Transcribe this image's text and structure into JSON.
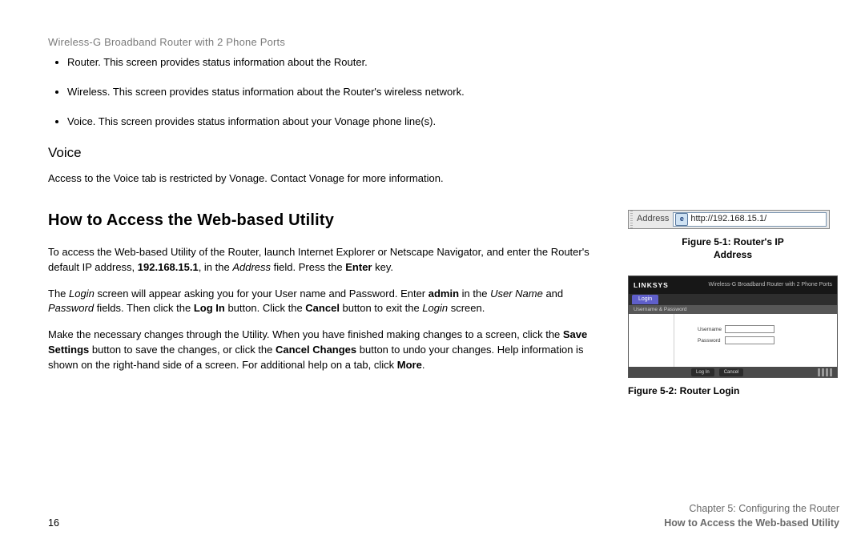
{
  "header": "Wireless-G Broadband Router with 2 Phone Ports",
  "bullets": {
    "b1": "Router. This screen provides status information about the Router.",
    "b2": "Wireless. This screen provides status information about the Router's wireless network.",
    "b3": "Voice. This screen provides status information about your Vonage phone line(s)."
  },
  "voice": {
    "heading": "Voice",
    "text": "Access to the Voice tab is restricted by Vonage. Contact Vonage for more information."
  },
  "access": {
    "heading": "How to Access the Web-based Utility",
    "p1a": "To access the Web-based Utility of the Router, launch Internet Explorer or Netscape Navigator, and enter the Router's default IP address, ",
    "p1_ip": "192.168.15.1",
    "p1b": ", in the ",
    "p1_addr": "Address",
    "p1c": " field. Press the ",
    "p1_enter": "Enter",
    "p1d": " key.",
    "p2a": "The ",
    "p2_login": "Login",
    "p2b": " screen will appear asking you for your User name and Password. Enter ",
    "p2_admin": "admin",
    "p2c": " in the ",
    "p2_username": "User Name",
    "p2d": " and ",
    "p2_password": "Password",
    "p2e": " fields. Then click the ",
    "p2_loginbtn": "Log In",
    "p2f": " button. Click the ",
    "p2_cancel": "Cancel",
    "p2g": " button to exit the ",
    "p2_loginscr": "Login",
    "p2h": " screen.",
    "p3a": "Make the necessary changes through the Utility. When you have finished making changes to a screen, click the ",
    "p3_save": "Save Settings",
    "p3b": " button to save the changes, or click the ",
    "p3_cancelchg": "Cancel Changes",
    "p3c": " button to undo your changes. Help information is shown on the right-hand side of a screen. For additional help on a tab, click ",
    "p3_more": "More",
    "p3d": "."
  },
  "figures": {
    "f1": {
      "address_label": "Address",
      "url": "http://192.168.15.1/",
      "caption_l1": "Figure 5-1: Router's IP",
      "caption_l2": "Address"
    },
    "f2": {
      "brand": "LINKSYS",
      "product": "Wireless-G Broadband Router with 2 Phone Ports",
      "tab": "Login",
      "subbar": "Username & Password",
      "field_user": "Username",
      "field_pass": "Password",
      "btn_login": "Log In",
      "btn_cancel": "Cancel",
      "caption": "Figure 5-2: Router Login"
    }
  },
  "footer": {
    "page": "16",
    "chapter": "Chapter 5: Configuring the Router",
    "section": "How to Access the Web-based Utility"
  }
}
